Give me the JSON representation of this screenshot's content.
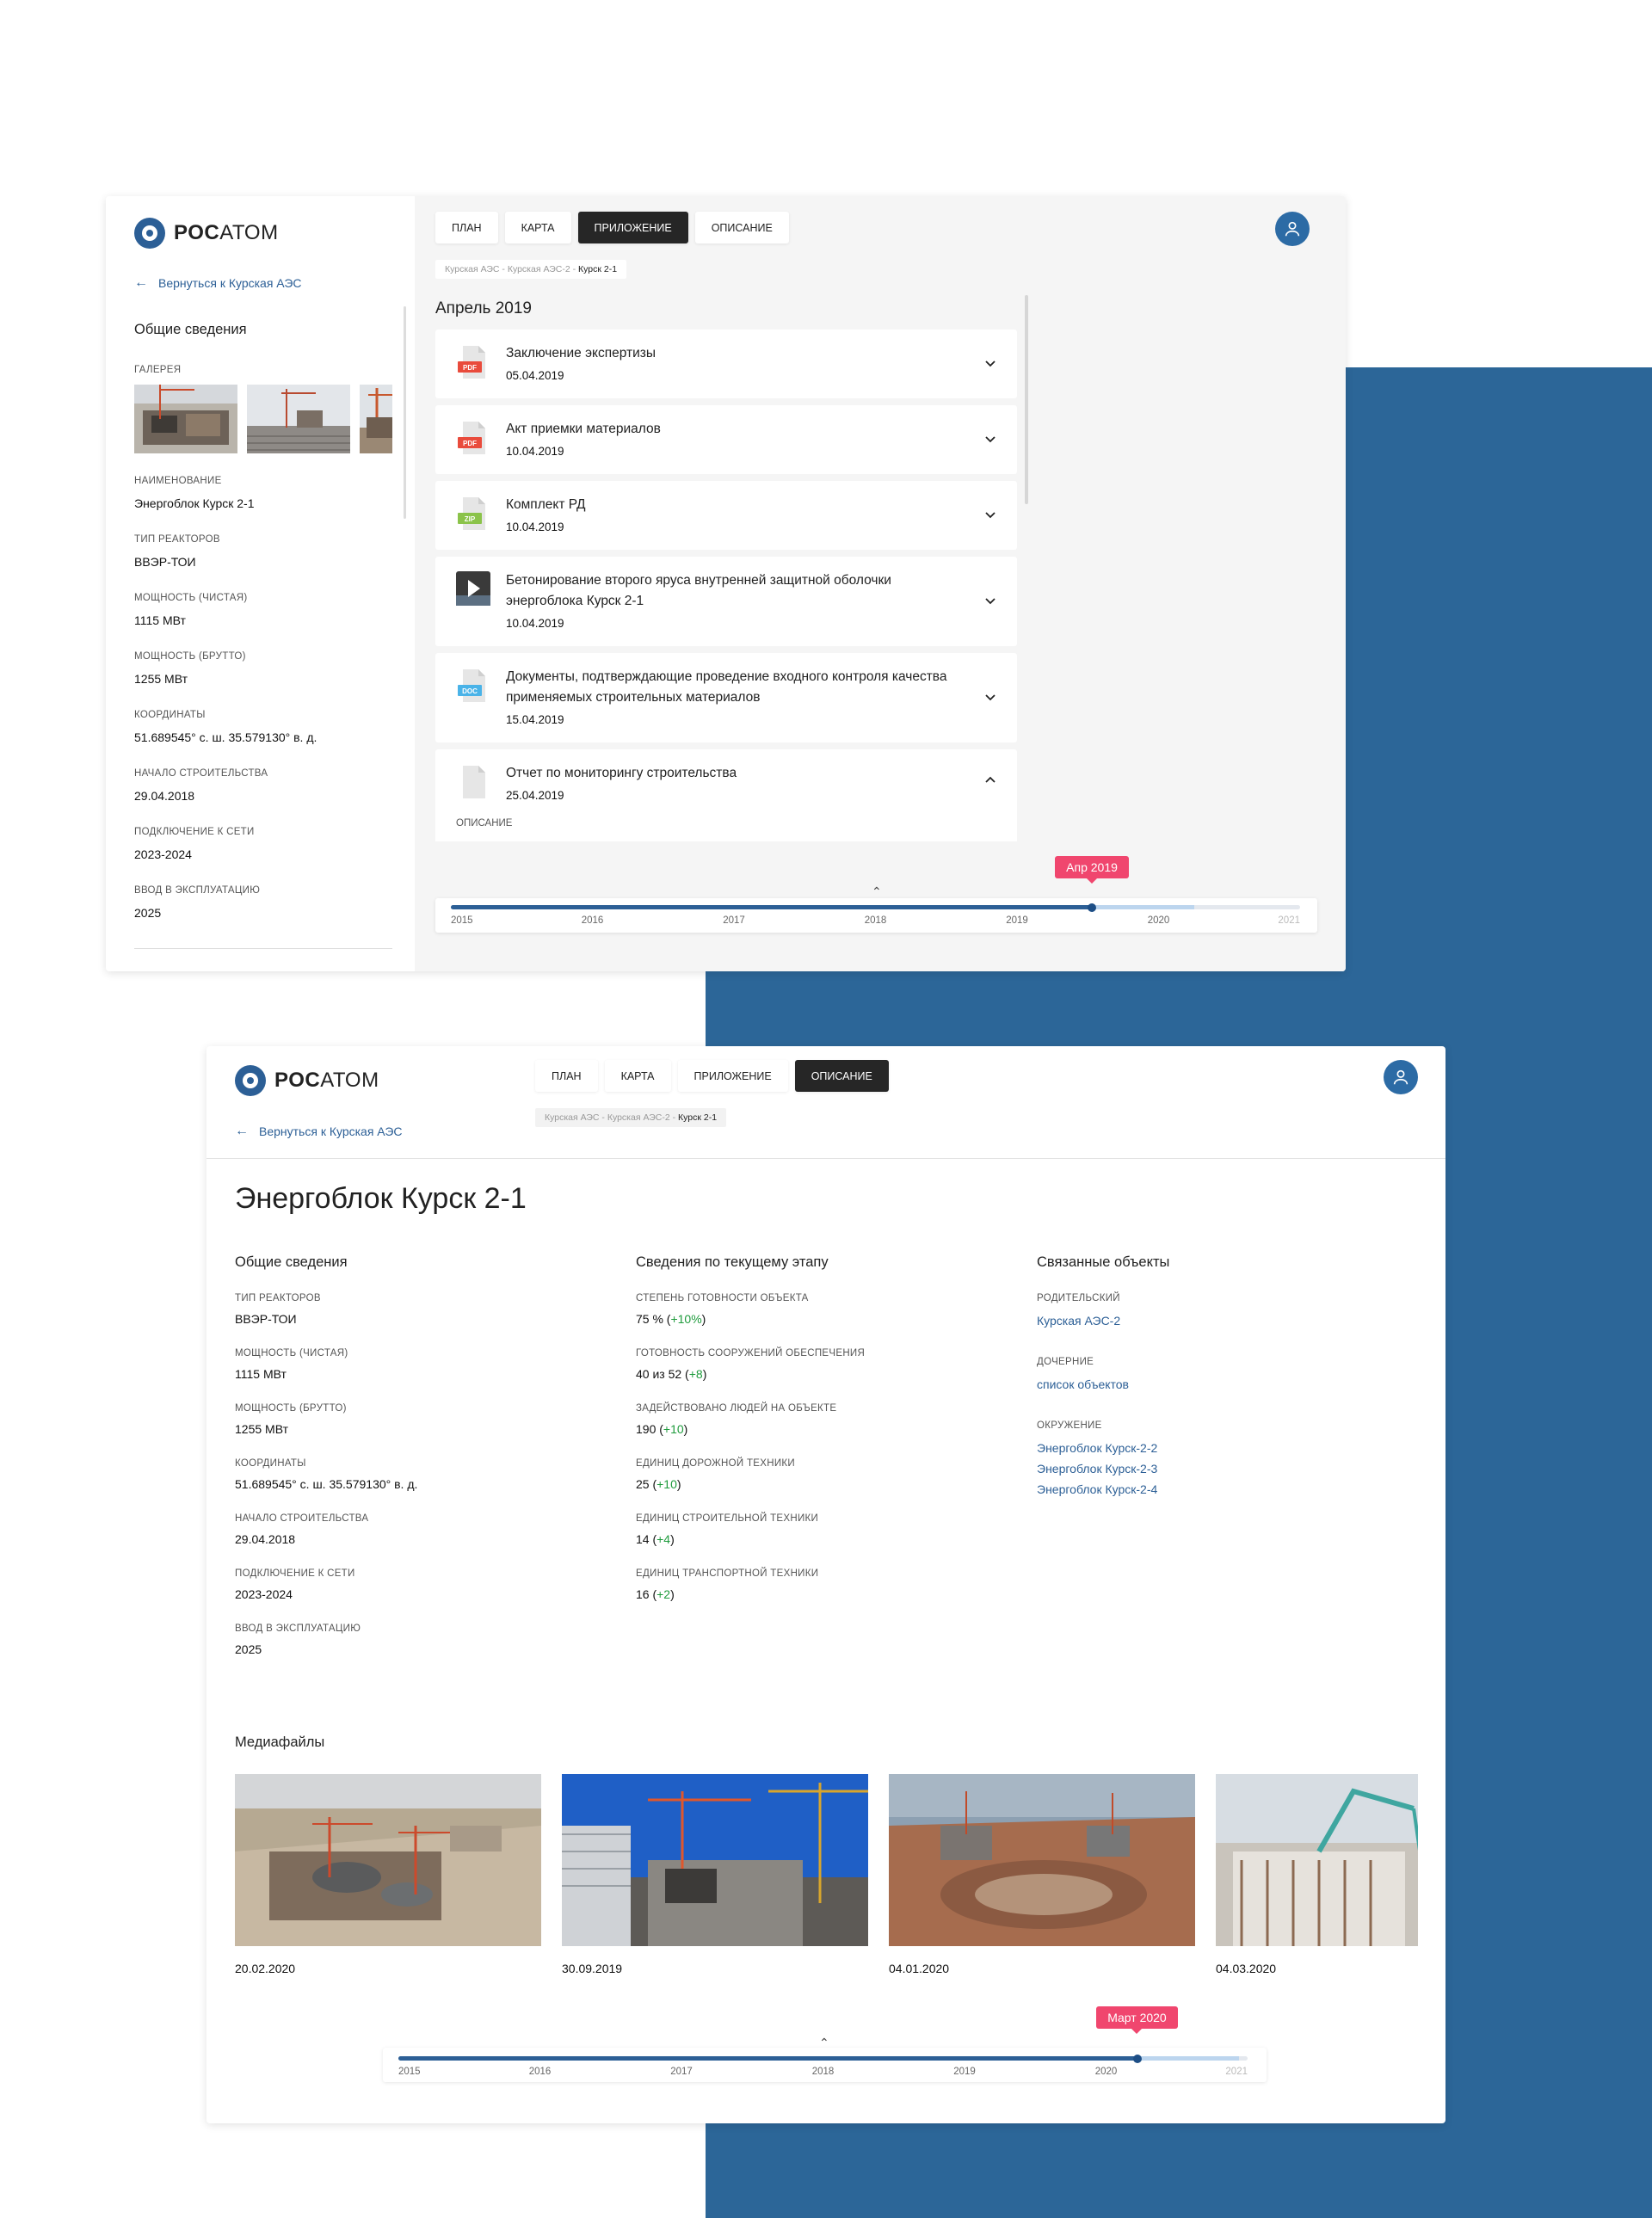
{
  "brand": {
    "name_bold": "РОС",
    "name_rest": "АТОМ"
  },
  "back_link": "Вернуться к Курская АЭС",
  "tabs": [
    {
      "label": "ПЛАН"
    },
    {
      "label": "КАРТА"
    },
    {
      "label": "ПРИЛОЖЕНИЕ"
    },
    {
      "label": "ОПИСАНИЕ"
    }
  ],
  "breadcrumb": {
    "path": "Курская АЭС - Курская АЭС-2 - ",
    "current": "Курск 2-1"
  },
  "screen1": {
    "active_tab": "ПРИЛОЖЕНИЕ",
    "general_title": "Общие сведения",
    "gallery_label": "ГАЛЕРЕЯ",
    "fields": [
      {
        "label": "НАИМЕНОВАНИЕ",
        "value": "Энергоблок Курск 2-1"
      },
      {
        "label": "ТИП РЕАКТОРОВ",
        "value": "ВВЭР-ТОИ"
      },
      {
        "label": "МОЩНОСТЬ (ЧИСТАЯ)",
        "value": "1115 МВт"
      },
      {
        "label": "МОЩНОСТЬ (БРУТТО)",
        "value": "1255 МВт"
      },
      {
        "label": "КООРДИНАТЫ",
        "value": "51.689545° с. ш.  35.579130° в. д."
      },
      {
        "label": "НАЧАЛО СТРОИТЕЛЬСТВА",
        "value": "29.04.2018"
      },
      {
        "label": "ПОДКЛЮЧЕНИЕ К СЕТИ",
        "value": "2023-2024"
      },
      {
        "label": "ВВОД В ЭКСПЛУАТАЦИЮ",
        "value": "2025"
      }
    ],
    "month_title": "Апрель 2019",
    "documents": [
      {
        "type": "PDF",
        "title": "Заключение экспертизы",
        "date": "05.04.2019",
        "expanded": false
      },
      {
        "type": "PDF",
        "title": "Акт приемки материалов",
        "date": "10.04.2019",
        "expanded": false
      },
      {
        "type": "ZIP",
        "title": "Комплект РД",
        "date": "10.04.2019",
        "expanded": false
      },
      {
        "type": "VIDEO",
        "title": "Бетонирование второго яруса внутренней защитной оболочки энергоблока Курск 2-1",
        "date": "10.04.2019",
        "expanded": false
      },
      {
        "type": "DOC",
        "title": "Документы, подтверждающие проведение входного контроля качества применяемых строительных материалов",
        "date": "15.04.2019",
        "expanded": false
      },
      {
        "type": "FILE",
        "title": "Отчет по мониторингу строительства",
        "date": "25.04.2019",
        "expanded": true,
        "description_label": "ОПИСАНИЕ"
      }
    ],
    "timeline": {
      "years": [
        "2015",
        "2016",
        "2017",
        "2018",
        "2019",
        "2020",
        "2021"
      ],
      "bubble": "Апр 2019",
      "position": 0.755
    }
  },
  "screen2": {
    "active_tab": "ОПИСАНИЕ",
    "title": "Энергоблок Курск 2-1",
    "general": {
      "title": "Общие сведения",
      "items": [
        {
          "label": "ТИП РЕАКТОРОВ",
          "value": "ВВЭР-ТОИ"
        },
        {
          "label": "МОЩНОСТЬ (ЧИСТАЯ)",
          "value": "1115 МВт"
        },
        {
          "label": "МОЩНОСТЬ (БРУТТО)",
          "value": "1255 МВт"
        },
        {
          "label": "КООРДИНАТЫ",
          "value": "51.689545° с. ш.  35.579130° в. д."
        },
        {
          "label": "НАЧАЛО СТРОИТЕЛЬСТВА",
          "value": "29.04.2018"
        },
        {
          "label": "ПОДКЛЮЧЕНИЕ К СЕТИ",
          "value": "2023-2024"
        },
        {
          "label": "ВВОД В ЭКСПЛУАТАЦИЮ",
          "value": "2025"
        }
      ]
    },
    "stage": {
      "title": "Сведения по текущему этапу",
      "items": [
        {
          "label": "СТЕПЕНЬ ГОТОВНОСТИ ОБЪЕКТА",
          "value": "75 % (",
          "delta": "+10%",
          "tail": ")"
        },
        {
          "label": "ГОТОВНОСТЬ СООРУЖЕНИЙ ОБЕСПЕЧЕНИЯ",
          "value": "40 из 52  (",
          "delta": "+8",
          "tail": ")"
        },
        {
          "label": "ЗАДЕЙСТВОВАНО ЛЮДЕЙ НА ОБЪЕКТЕ",
          "value": "190 (",
          "delta": "+10",
          "tail": ")"
        },
        {
          "label": "ЕДИНИЦ ДОРОЖНОЙ ТЕХНИКИ",
          "value": "25 (",
          "delta": "+10",
          "tail": ")"
        },
        {
          "label": "ЕДИНИЦ СТРОИТЕЛЬНОЙ ТЕХНИКИ",
          "value": "14 (",
          "delta": "+4",
          "tail": ")"
        },
        {
          "label": "ЕДИНИЦ ТРАНСПОРТНОЙ ТЕХНИКИ",
          "value": "16 (",
          "delta": "+2",
          "tail": ")"
        }
      ]
    },
    "related": {
      "title": "Связанные объекты",
      "parent_label": "РОДИТЕЛЬСКИЙ",
      "parent": "Курская АЭС-2",
      "children_label": "ДОЧЕРНИЕ",
      "children": "список объектов",
      "surround_label": "ОКРУЖЕНИЕ",
      "surround": [
        "Энергоблок Курск-2-2",
        "Энергоблок Курск-2-3",
        "Энергоблок Курск-2-4"
      ]
    },
    "media_title": "Медиафайлы",
    "media": [
      {
        "date": "20.02.2020"
      },
      {
        "date": "30.09.2019"
      },
      {
        "date": "04.01.2020"
      },
      {
        "date": "04.03.2020"
      }
    ],
    "timeline": {
      "years": [
        "2015",
        "2016",
        "2017",
        "2018",
        "2019",
        "2020",
        "2021"
      ],
      "bubble": "Март 2020",
      "position": 0.87
    }
  },
  "colors": {
    "brand_blue": "#2c5f96",
    "background_blue": "#2c6698",
    "accent_pink": "#f0466e",
    "positive_green": "#1e9b3c",
    "active_tab": "#262626"
  }
}
